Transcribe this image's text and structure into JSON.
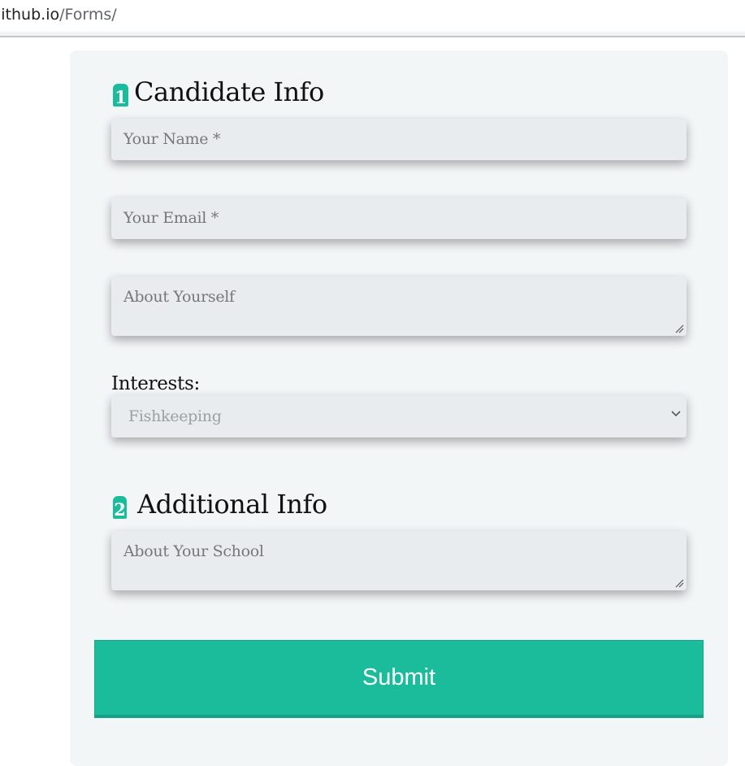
{
  "browser": {
    "url_host": "jithub.io",
    "url_path": "/Forms/"
  },
  "sections": [
    {
      "number": "1",
      "title": "Candidate Info"
    },
    {
      "number": "2",
      "title": "Additional Info"
    }
  ],
  "fields": {
    "name_placeholder": "Your Name *",
    "email_placeholder": "Your Email *",
    "about_yourself_placeholder": "About Yourself",
    "interests_label": "Interests:",
    "interests_selected": "Fishkeeping",
    "about_school_placeholder": "About Your School"
  },
  "submit_label": "Submit",
  "colors": {
    "accent": "#1abc9c",
    "card_background": "#f3f6f7",
    "field_background": "#e8ecee"
  },
  "icons": {
    "select_arrow": "chevron-down-icon",
    "textarea_resize": "resize-handle-icon"
  }
}
